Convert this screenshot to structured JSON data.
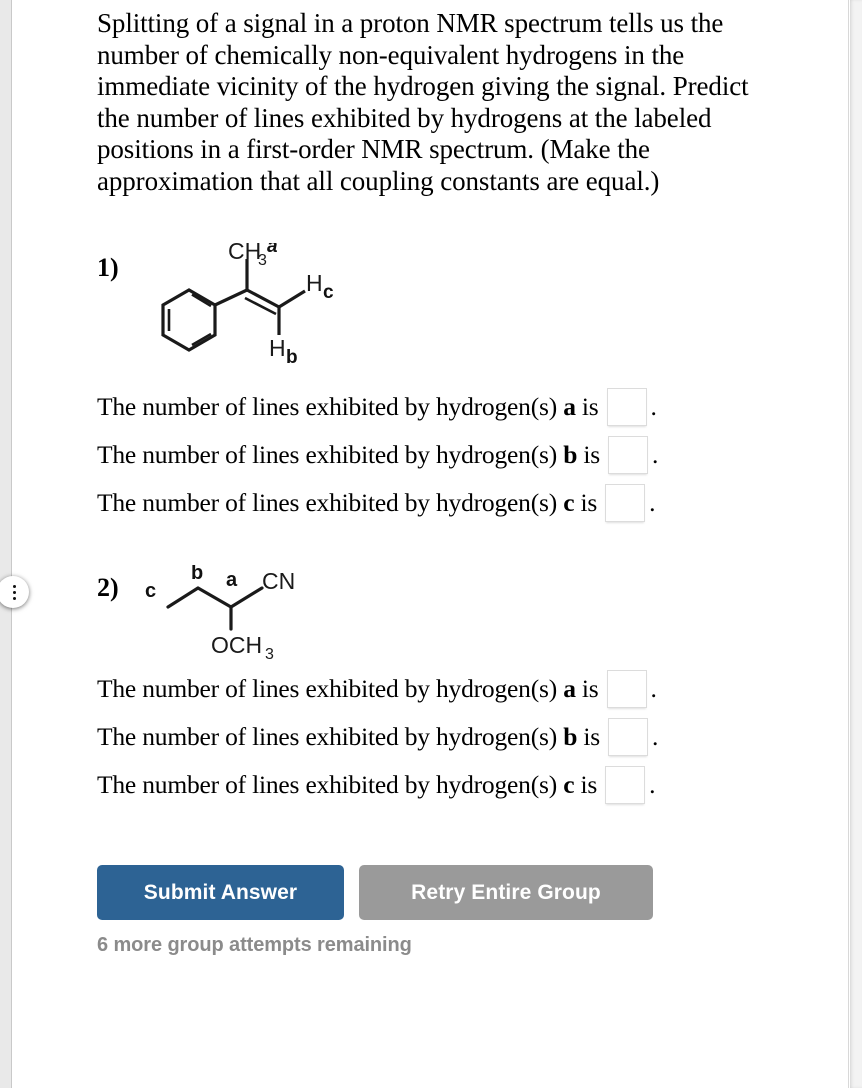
{
  "intro": {
    "text": "Splitting of a signal in a proton NMR spectrum tells us the number of chemically non-equivalent hydrogens in the immediate vicinity of the hydrogen giving the signal. Predict the number of lines exhibited by hydrogens at the labeled positions in a first-order NMR spectrum. (Make the approximation that all coupling constants are equal.)"
  },
  "questions": [
    {
      "number": "1)",
      "structure": {
        "name": "2-phenylpropene",
        "labels": {
          "methyl": "CH",
          "methyl_sub": "3",
          "methyl_tag": "a",
          "h_right": "H",
          "h_right_tag": "c",
          "h_bottom": "H",
          "h_bottom_tag": "b"
        }
      },
      "answers": [
        {
          "prefix": "The number of lines exhibited by hydrogen(s) ",
          "label": "a",
          "suffix": " is",
          "value": "",
          "period": "."
        },
        {
          "prefix": "The number of lines exhibited by hydrogen(s) ",
          "label": "b",
          "suffix": " is",
          "value": "",
          "period": "."
        },
        {
          "prefix": "The number of lines exhibited by hydrogen(s) ",
          "label": "c",
          "suffix": " is",
          "value": "",
          "period": "."
        }
      ]
    },
    {
      "number": "2)",
      "structure": {
        "name": "2-methoxybutanenitrile",
        "labels": {
          "tag_c": "c",
          "tag_b": "b",
          "tag_a": "a",
          "nitrile": "CN",
          "methoxy": "OCH",
          "methoxy_sub": "3"
        }
      },
      "answers": [
        {
          "prefix": "The number of lines exhibited by hydrogen(s) ",
          "label": "a",
          "suffix": " is",
          "value": "",
          "period": "."
        },
        {
          "prefix": "The number of lines exhibited by hydrogen(s) ",
          "label": "b",
          "suffix": " is",
          "value": "",
          "period": "."
        },
        {
          "prefix": "The number of lines exhibited by hydrogen(s) ",
          "label": "c",
          "suffix": " is",
          "value": "",
          "period": "."
        }
      ]
    }
  ],
  "footer": {
    "submit_label": "Submit Answer",
    "retry_label": "Retry Entire Group",
    "attempts_text": "6 more group attempts remaining"
  },
  "colors": {
    "submit_bg": "#2d6394",
    "retry_bg": "#9a9a9a",
    "attempts_text": "#8b8b8b",
    "page_bg": "#ffffff",
    "gutter": "#e9e9e9"
  }
}
